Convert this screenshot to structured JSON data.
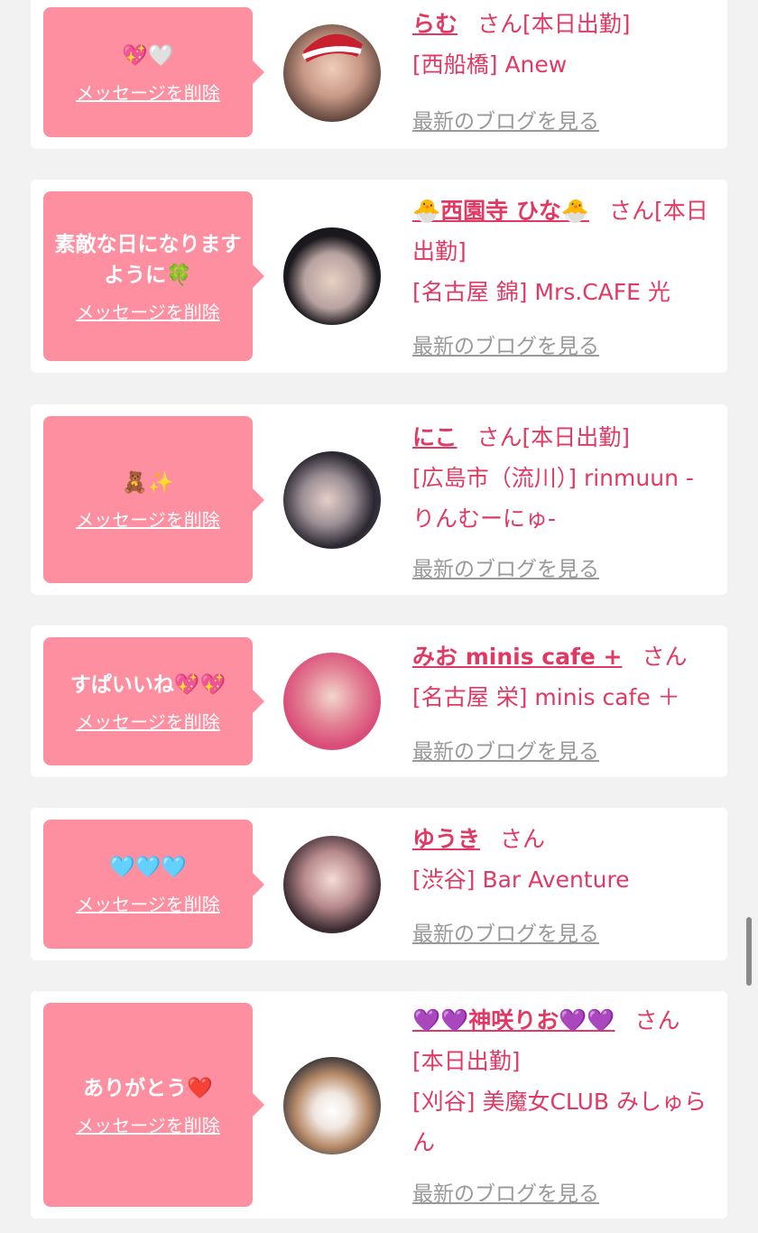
{
  "delete_label": "メッセージを削除",
  "blog_label": "最新のブログを見る",
  "san_label": "さん",
  "entries": [
    {
      "message": "💖🤍",
      "name": "らむ",
      "status": "[本日出勤]",
      "store": "[西船橋] Anew"
    },
    {
      "message": "素敵な日になりますように🍀",
      "name": "🐣西園寺 ひな🐣",
      "status": "[本日出勤]",
      "store": "[名古屋 錦] Mrs.CAFE 光"
    },
    {
      "message": "🧸✨",
      "name": "にこ",
      "status": "[本日出勤]",
      "store": "[広島市（流川）] rinmuun -りんむーにゅ-"
    },
    {
      "message": "すぱいいね💖💖",
      "name": "みお minis cafe +",
      "status": "",
      "store": "[名古屋 栄] minis cafe ＋"
    },
    {
      "message": "🩵🩵🩵",
      "name": "ゆうき",
      "status": "",
      "store": "[渋谷] Bar Aventure"
    },
    {
      "message": "ありがとう❤️",
      "name": "💜💜神咲りお💜💜",
      "status": "[本日出勤]",
      "store": "[刈谷] 美魔女CLUB みしゅらん"
    }
  ],
  "colors": {
    "bubble": "#fd8fa0",
    "accent": "#e03a64",
    "link_gray": "#999999",
    "background": "#f2f2f2"
  }
}
